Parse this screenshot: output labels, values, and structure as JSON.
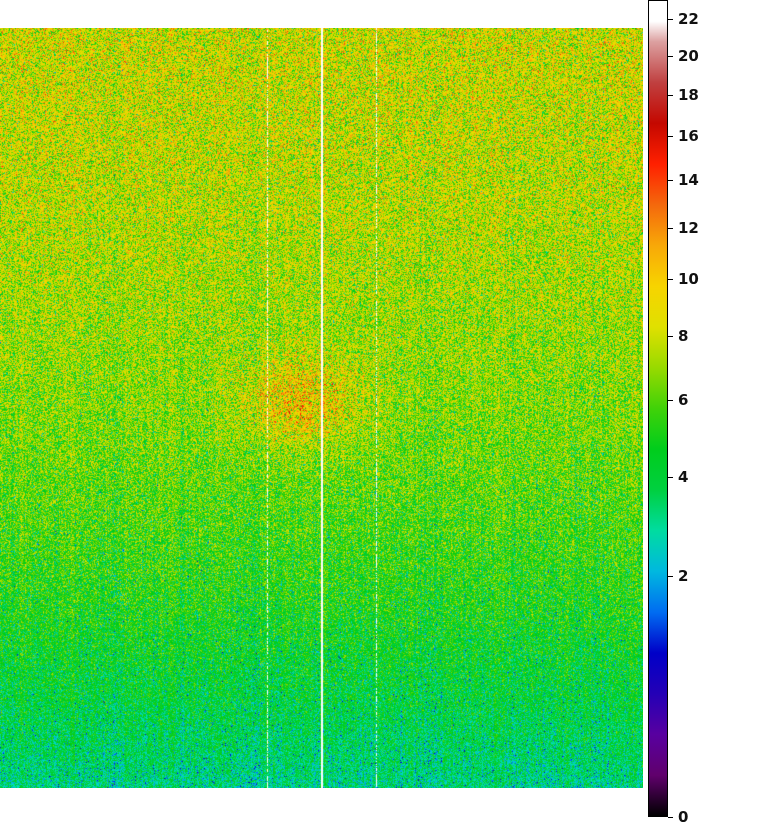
{
  "chart_data": {
    "type": "heatmap",
    "title": "",
    "xlabel": "",
    "ylabel": "",
    "scale": "sqrt",
    "colorbar": {
      "range": [
        0,
        22
      ],
      "ticks": [
        22,
        20,
        18,
        16,
        14,
        12,
        10,
        8,
        6,
        4,
        2,
        0
      ],
      "tick_labels": [
        "22",
        "20",
        "18",
        "16",
        "14",
        "12",
        "10",
        "8",
        "6",
        "4",
        "2",
        "0"
      ],
      "colormap": [
        "#000000",
        "#800090",
        "#3000b0",
        "#0000c8",
        "#0090ff",
        "#00e0c0",
        "#00d040",
        "#00cc10",
        "#80d800",
        "#e0e000",
        "#ffd000",
        "#f08010",
        "#ff2000",
        "#b00000",
        "#d08080",
        "#ffffff"
      ]
    },
    "approx_values": {
      "top_mean": 8,
      "bottom_mean": 3,
      "hotspot_peak": 12
    }
  }
}
